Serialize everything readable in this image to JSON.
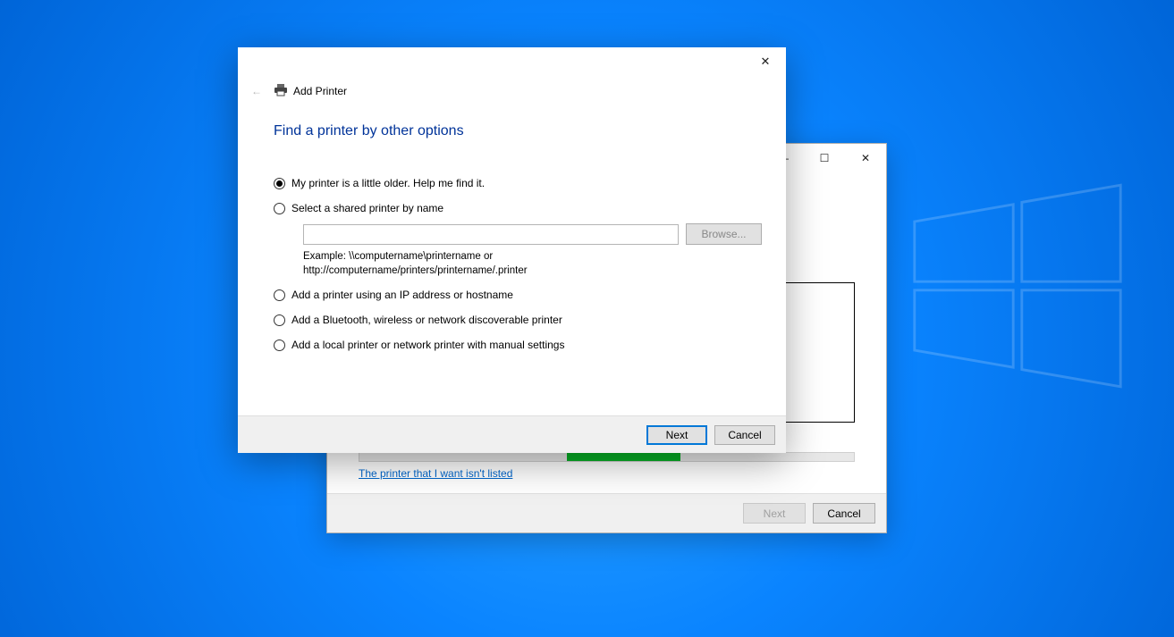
{
  "back_window": {
    "minimize_glyph": "—",
    "maximize_glyph": "☐",
    "close_glyph": "✕",
    "link_text": "The printer that I want isn't listed",
    "next_label": "Next",
    "cancel_label": "Cancel"
  },
  "front_window": {
    "close_glyph": "✕",
    "back_arrow": "←",
    "nav_title": "Add Printer",
    "heading": "Find a printer by other options",
    "options": {
      "older": "My printer is a little older. Help me find it.",
      "shared": "Select a shared printer by name",
      "tcpip": "Add a printer using an IP address or hostname",
      "wireless": "Add a Bluetooth, wireless or network discoverable printer",
      "local": "Add a local printer or network printer with manual settings"
    },
    "shared_input_value": "",
    "browse_label": "Browse...",
    "example_line1": "Example: \\\\computername\\printername or",
    "example_line2": "http://computername/printers/printername/.printer",
    "next_label": "Next",
    "cancel_label": "Cancel"
  }
}
